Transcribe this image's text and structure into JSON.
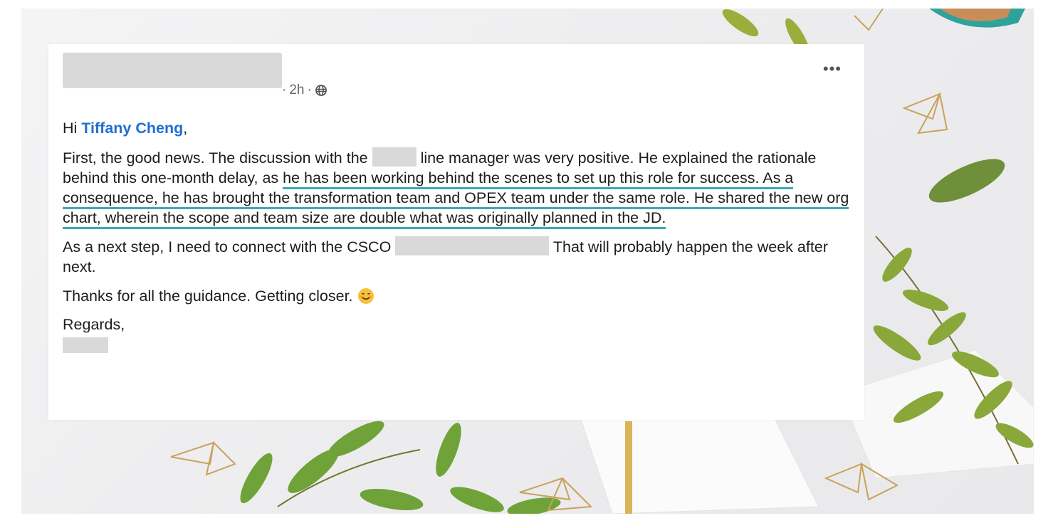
{
  "post": {
    "timestamp": "2h",
    "separator": "·",
    "more_label": "•••",
    "greeting_prefix": "Hi",
    "mention": "Tiffany Cheng",
    "greeting_suffix": ",",
    "p1": {
      "a": "First, the good news. The discussion with the",
      "b": "line manager was very positive. He explained the rationale behind this one-month delay, as",
      "highlight": "he has been working behind the scenes to set up this role for success. As a consequence, he has brought the transformation team and OPEX team under the same role. He shared the new org chart, wherein the scope and team size are double what was originally planned in the JD."
    },
    "p2": {
      "a": "As a next step, I need to connect with the CSCO",
      "b": "That will probably happen the week after next."
    },
    "p3": "Thanks for all the guidance. Getting closer.",
    "p4": "Regards,"
  },
  "icons": {
    "visibility": "globe-icon",
    "more": "more-icon",
    "emoji": "smiling-face-emoji-icon"
  },
  "colors": {
    "mention": "#1f6fd0",
    "highlight_underline": "#3ba9b8",
    "redaction": "#d9d9d9"
  }
}
